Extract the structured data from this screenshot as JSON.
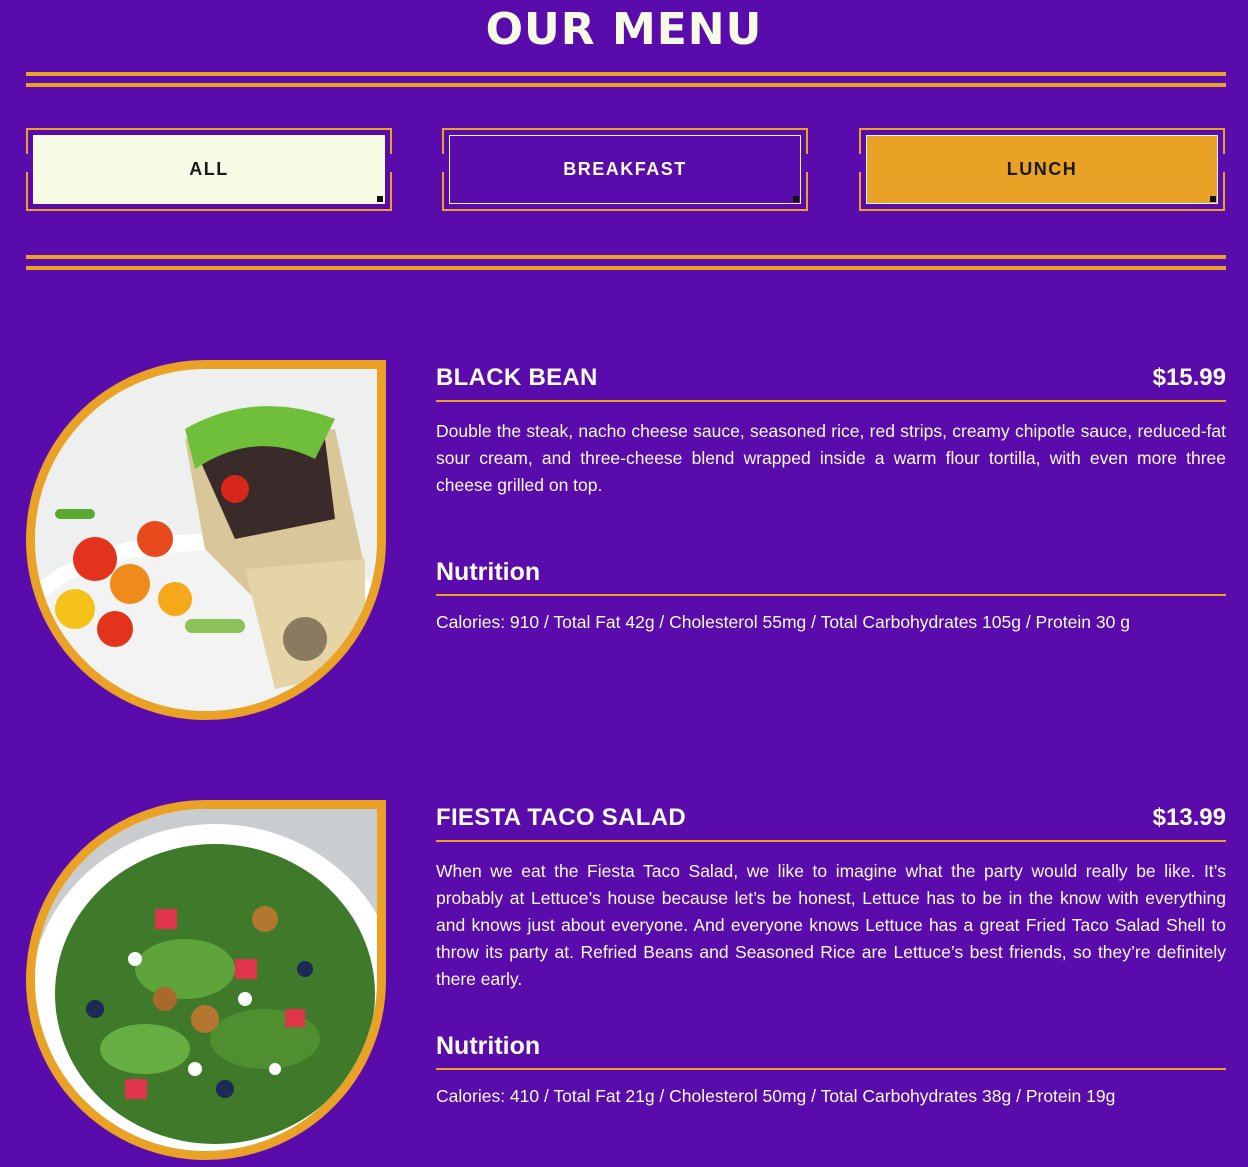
{
  "page": {
    "title": "OUR MENU"
  },
  "tabs": [
    {
      "label": "ALL"
    },
    {
      "label": "BREAKFAST"
    },
    {
      "label": "LUNCH"
    }
  ],
  "colors": {
    "background": "#5a0bac",
    "accent": "#e9a126",
    "cream": "#f6fbe6"
  },
  "items": [
    {
      "name": "BLACK BEAN",
      "price": "$15.99",
      "description": "Double the steak, nacho cheese sauce, seasoned rice, red strips, creamy chipotle sauce, reduced-fat sour cream, and three-cheese blend wrapped inside a warm flour tortilla, with even more three cheese grilled on top.",
      "nutrition_title": "Nutrition",
      "nutrition": "Calories: 910 / Total Fat 42g / Cholesterol 55mg / Total Carbohydrates 105g / Protein 30 g",
      "image_icon": "burrito-image"
    },
    {
      "name": "FIESTA TACO SALAD",
      "price": "$13.99",
      "description": "When we eat the Fiesta Taco Salad, we like to imagine what the party would really be like. It’s probably at Lettuce’s house because let’s be honest, Lettuce has to be in the know with everything and knows just about everyone. And everyone knows Lettuce has a great Fried Taco Salad Shell to throw its party at. Refried Beans and Seasoned Rice are Lettuce’s best friends, so they’re definitely there early.",
      "nutrition_title": "Nutrition",
      "nutrition": "Calories: 410 / Total Fat 21g / Cholesterol 50mg / Total Carbohydrates 38g / Protein 19g",
      "image_icon": "salad-image"
    }
  ]
}
